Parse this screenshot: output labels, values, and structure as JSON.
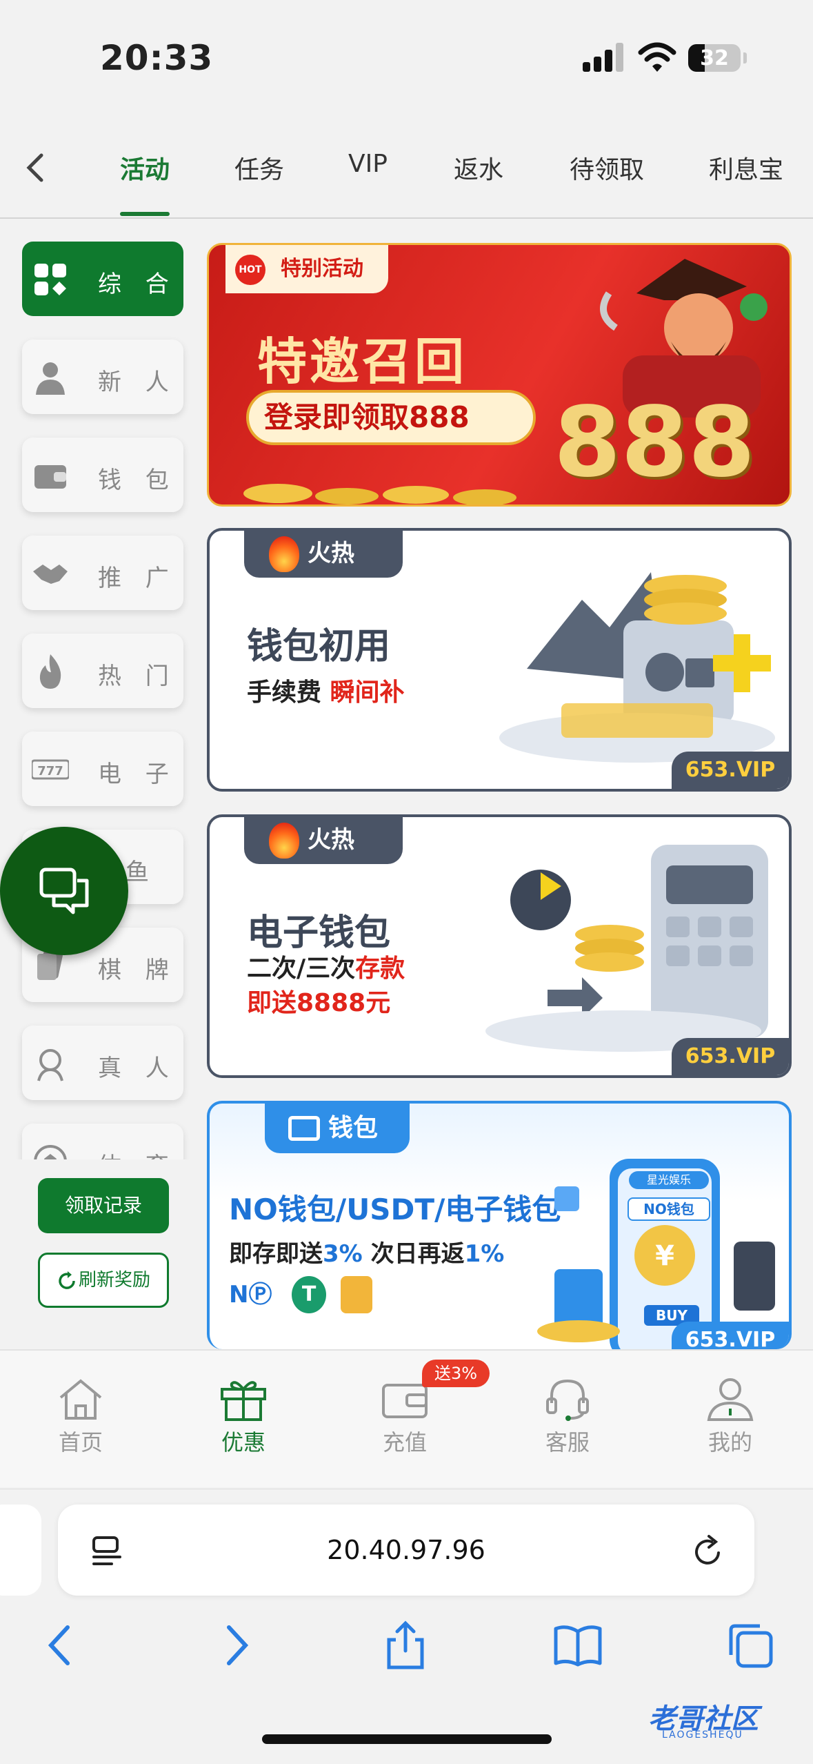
{
  "status_bar": {
    "time": "20:33",
    "battery": "32"
  },
  "top_tabs": [
    "活动",
    "任务",
    "VIP",
    "返水",
    "待领取",
    "利息宝"
  ],
  "sidebar": {
    "items": [
      {
        "label": "综 合",
        "icon": "grid-icon"
      },
      {
        "label": "新 人",
        "icon": "person-icon"
      },
      {
        "label": "钱 包",
        "icon": "wallet-icon"
      },
      {
        "label": "推 广",
        "icon": "handshake-icon"
      },
      {
        "label": "热 门",
        "icon": "flame-icon"
      },
      {
        "label": "电 子",
        "icon": "slot-777-icon"
      },
      {
        "label": "鱼",
        "icon": "fish-icon"
      },
      {
        "label": "棋 牌",
        "icon": "cards-icon"
      },
      {
        "label": "真 人",
        "icon": "dealer-icon"
      },
      {
        "label": "体 育",
        "icon": "ball-icon"
      }
    ],
    "record_button": "领取记录",
    "refresh_button": "刷新奖励"
  },
  "banners": {
    "b1": {
      "tag": "特别活动",
      "tag_icon": "HOT",
      "title": "特邀召回",
      "pill": "登录即领取888",
      "big_number": "888"
    },
    "b2": {
      "tag": "火热",
      "title": "钱包初用",
      "sub_plain": "手续费 ",
      "sub_red": "瞬间补",
      "vip": "653.VIP"
    },
    "b3": {
      "tag": "火热",
      "title": "电子钱包",
      "line1_plain": "二次/三次",
      "line1_red": "存款",
      "line2": "即送8888元",
      "vip": "653.VIP"
    },
    "b4": {
      "tag": "钱包",
      "title": "NO钱包/USDT/电子钱包",
      "sub_a": "即存即送",
      "sub_b": "3%",
      "sub_c": " 次日再返",
      "sub_d": "1%",
      "phone_brand": "星光娱乐",
      "phone_label": "NO钱包",
      "buy": "BUY",
      "vip": "653.VIP"
    }
  },
  "bottom_nav": {
    "items": [
      {
        "label": "首页",
        "icon": "home-icon"
      },
      {
        "label": "优惠",
        "icon": "gift-icon"
      },
      {
        "label": "充值",
        "icon": "deposit-icon"
      },
      {
        "label": "客服",
        "icon": "headset-icon"
      },
      {
        "label": "我的",
        "icon": "profile-icon"
      }
    ],
    "badge": "送3%",
    "active": "优惠"
  },
  "browser": {
    "url": "20.40.97.96"
  },
  "watermark": {
    "main": "老哥社区",
    "sub": "LAOGESHEQU"
  },
  "colors": {
    "accent": "#1b7a34",
    "sidebar_active": "#0f7a2e",
    "banner_red": "#e1251b",
    "banner_blue": "#2f8fe8"
  }
}
